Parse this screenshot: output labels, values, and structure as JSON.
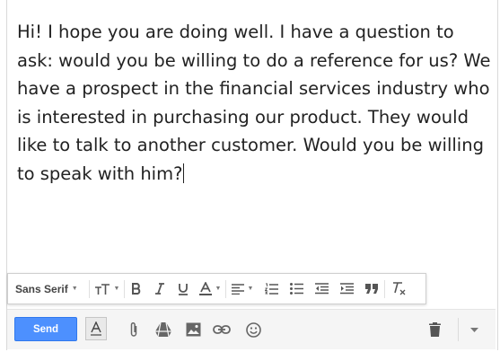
{
  "message": {
    "body": "Hi! I hope you are doing well. I have a question to ask: would you be willing to do a reference for us? We have a prospect in the financial services industry who is interested in purchasing our product. They would like to talk to another customer. Would you be willing to speak with him?"
  },
  "format_toolbar": {
    "font": "Sans Serif",
    "icons": [
      "text-size-icon",
      "bold-icon",
      "italic-icon",
      "underline-icon",
      "text-color-icon",
      "align-icon",
      "numbered-list-icon",
      "bulleted-list-icon",
      "indent-less-icon",
      "indent-more-icon",
      "quote-icon",
      "remove-formatting-icon"
    ]
  },
  "bottom_toolbar": {
    "send_label": "Send",
    "icons": [
      "formatting-options-icon",
      "attach-icon",
      "drive-icon",
      "insert-photo-icon",
      "insert-link-icon",
      "emoji-icon",
      "trash-icon",
      "more-options-icon"
    ]
  },
  "colors": {
    "send": "#4d90fe",
    "text": "#222222",
    "icon": "#666666"
  }
}
